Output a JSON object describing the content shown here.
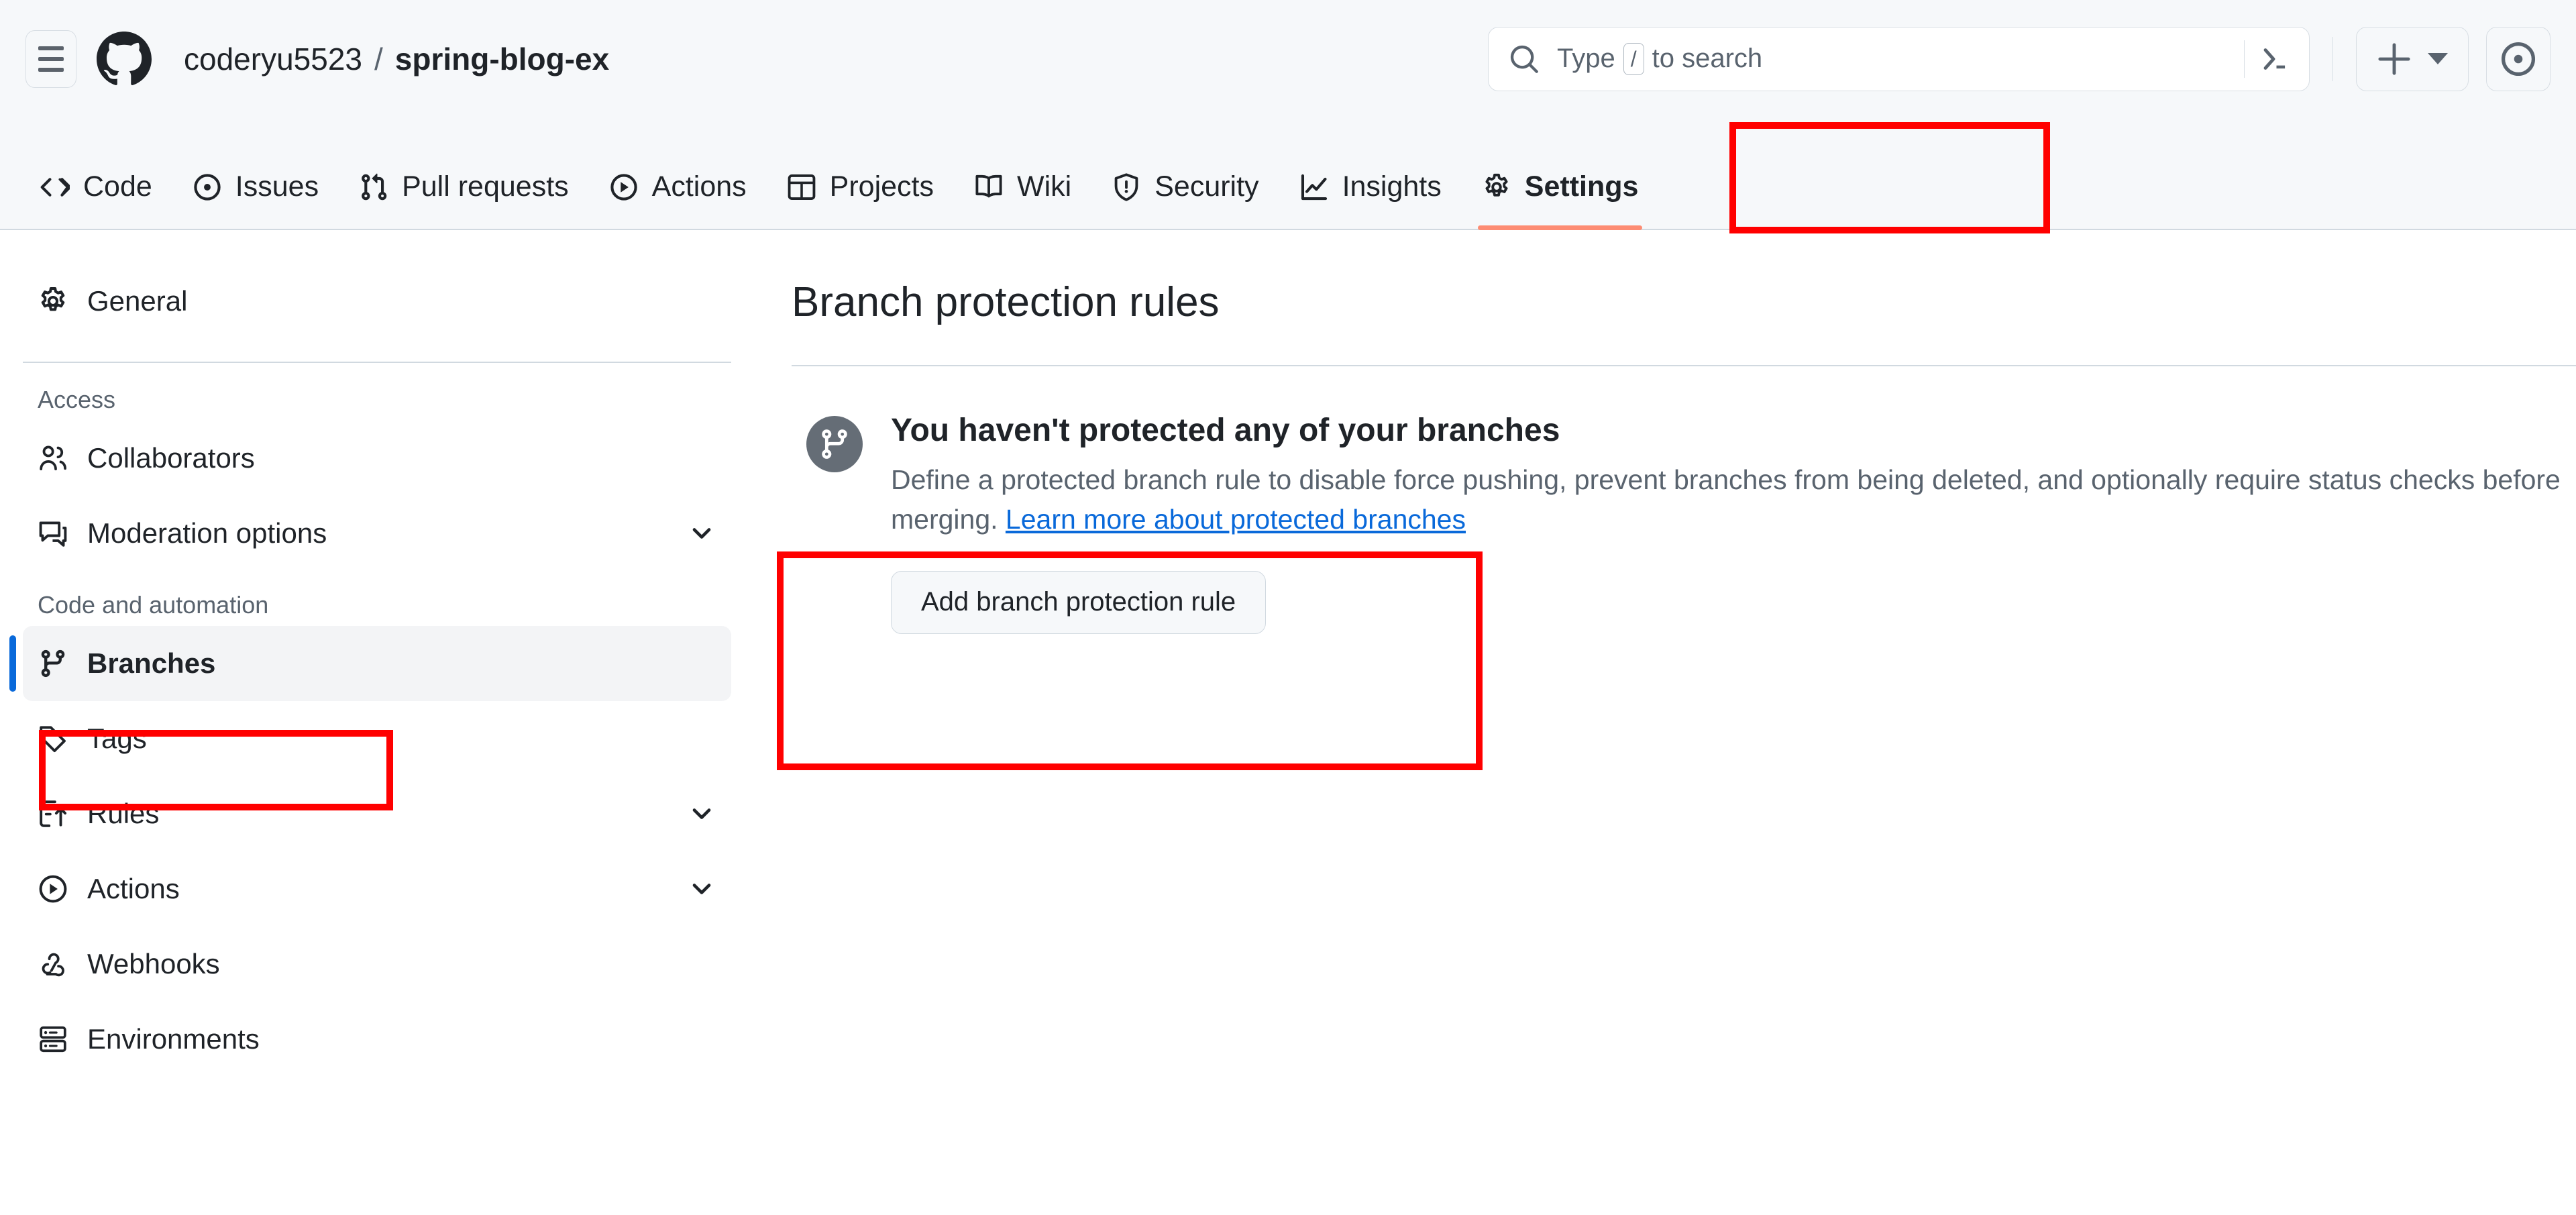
{
  "header": {
    "menu_icon": "hamburger-icon",
    "logo_icon": "github-logo-icon",
    "breadcrumb": {
      "owner": "coderyu5523",
      "separator": "/",
      "repo": "spring-blog-ex"
    },
    "search": {
      "icon": "search-icon",
      "placeholder_prefix": "Type",
      "placeholder_key": "/",
      "placeholder_suffix": "to search",
      "terminal_icon": "terminal-icon"
    },
    "create_new": {
      "icon": "plus-icon",
      "caret": "chevron-down-icon"
    },
    "issues_button": {
      "icon": "issue-opened-icon"
    }
  },
  "repo_nav": {
    "active": "Settings",
    "items": [
      {
        "label": "Code",
        "icon": "code-icon"
      },
      {
        "label": "Issues",
        "icon": "issue-opened-icon"
      },
      {
        "label": "Pull requests",
        "icon": "git-pull-request-icon"
      },
      {
        "label": "Actions",
        "icon": "play-icon"
      },
      {
        "label": "Projects",
        "icon": "table-icon"
      },
      {
        "label": "Wiki",
        "icon": "book-icon"
      },
      {
        "label": "Security",
        "icon": "shield-icon"
      },
      {
        "label": "Insights",
        "icon": "graph-icon"
      },
      {
        "label": "Settings",
        "icon": "gear-icon"
      }
    ]
  },
  "sidebar": {
    "top_items": [
      {
        "label": "General",
        "icon": "gear-icon",
        "chevron": false,
        "selected": false
      }
    ],
    "sections": [
      {
        "title": "Access",
        "items": [
          {
            "label": "Collaborators",
            "icon": "people-icon",
            "chevron": false,
            "selected": false
          },
          {
            "label": "Moderation options",
            "icon": "comment-icon",
            "chevron": true,
            "selected": false
          }
        ]
      },
      {
        "title": "Code and automation",
        "items": [
          {
            "label": "Branches",
            "icon": "git-branch-icon",
            "chevron": false,
            "selected": true
          },
          {
            "label": "Tags",
            "icon": "tag-icon",
            "chevron": false,
            "selected": false
          },
          {
            "label": "Rules",
            "icon": "rules-icon",
            "chevron": true,
            "selected": false
          },
          {
            "label": "Actions",
            "icon": "play-icon",
            "chevron": true,
            "selected": false
          },
          {
            "label": "Webhooks",
            "icon": "webhook-icon",
            "chevron": false,
            "selected": false
          },
          {
            "label": "Environments",
            "icon": "server-icon",
            "chevron": false,
            "selected": false
          }
        ]
      }
    ]
  },
  "main": {
    "page_title": "Branch protection rules",
    "blankslate": {
      "icon": "git-branch-icon",
      "heading": "You haven't protected any of your branches",
      "description": "Define a protected branch rule to disable force pushing, prevent branches from being deleted, and optionally require status checks before merging.",
      "link_text": "Learn more about protected branches",
      "button_label": "Add branch protection rule"
    }
  },
  "annotations": {
    "color": "#ff0000",
    "boxes": [
      {
        "name": "settings-tab-highlight"
      },
      {
        "name": "branches-sidebar-highlight"
      },
      {
        "name": "add-rule-highlight"
      }
    ]
  }
}
